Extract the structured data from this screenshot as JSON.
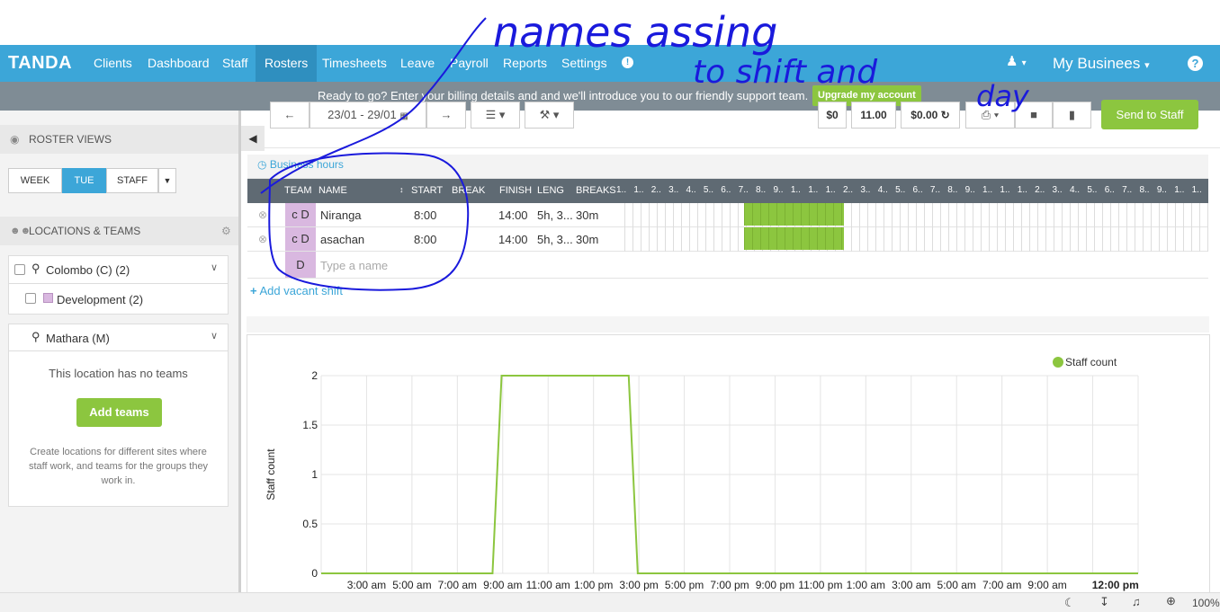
{
  "nav": {
    "logo": "TANDA",
    "items": [
      "Clients",
      "Dashboard",
      "Staff",
      "Rosters",
      "Timesheets",
      "Leave",
      "Payroll",
      "Reports",
      "Settings"
    ],
    "active": "Rosters",
    "business": "My Businees",
    "help_icon": "help-circle-icon"
  },
  "banner": {
    "text": "Ready to go? Enter your billing details and and we'll introduce you to our friendly support team.",
    "button": "Upgrade my account"
  },
  "left": {
    "roster_views": "ROSTER VIEWS",
    "view_buttons": [
      "WEEK",
      "TUE",
      "STAFF"
    ],
    "view_active": "TUE",
    "locations_title": "LOCATIONS & TEAMS",
    "loc1": "Colombo (C) (2)",
    "loc1_team": "Development (2)",
    "loc2": "Mathara (M)",
    "no_teams": "This location has no teams",
    "add_teams": "Add teams",
    "help_text": "Create locations for different sites where staff work, and teams for the groups they work in."
  },
  "toolbar": {
    "date_range": "23/01 - 29/01",
    "cost": "$0",
    "hours": "11.00",
    "wage": "$0.00",
    "send": "Send to Staff"
  },
  "business_hours": "Business hours",
  "table": {
    "headers": {
      "team": "TEAM",
      "name": "NAME",
      "start": "START",
      "break": "BREAK",
      "finish": "FINISH",
      "length": "LENG",
      "breaks": "BREAKS"
    },
    "hour_labels": [
      "1..",
      "1..",
      "2..",
      "3..",
      "4..",
      "5..",
      "6..",
      "7..",
      "8..",
      "9..",
      "1..",
      "1..",
      "1..",
      "2..",
      "3..",
      "4..",
      "5..",
      "6..",
      "7..",
      "8..",
      "9..",
      "1..",
      "1..",
      "1..",
      "2..",
      "3..",
      "4..",
      "5..",
      "6..",
      "7..",
      "8..",
      "9..",
      "1..",
      "1.."
    ],
    "rows": [
      {
        "team": "c D",
        "name": "Niranga",
        "start": "8:00",
        "finish": "14:00",
        "length": "5h, 3...",
        "breaks": "30m"
      },
      {
        "team": "c D",
        "name": "asachan",
        "start": "8:00",
        "finish": "14:00",
        "length": "5h, 3...",
        "breaks": "30m"
      }
    ],
    "new_row_team": "D",
    "new_row_placeholder": "Type a name",
    "add_vacant": "Add vacant shift"
  },
  "chart_data": {
    "type": "line",
    "title": "",
    "xlabel": "",
    "ylabel": "Staff count",
    "ylim": [
      0,
      2
    ],
    "yticks": [
      "0",
      "0.5",
      "1",
      "1.5",
      "2"
    ],
    "x": [
      "3:00 am",
      "5:00 am",
      "7:00 am",
      "9:00 am",
      "11:00 am",
      "1:00 pm",
      "3:00 pm",
      "5:00 pm",
      "7:00 pm",
      "9:00 pm",
      "11:00 pm",
      "1:00 am",
      "3:00 am",
      "5:00 am",
      "7:00 am",
      "9:00 am",
      "12:00 pm"
    ],
    "series": [
      {
        "name": "Staff count",
        "color": "#8cc63f",
        "points": [
          [
            0,
            0
          ],
          [
            7.55,
            0
          ],
          [
            7.95,
            2
          ],
          [
            13.55,
            2
          ],
          [
            13.95,
            0
          ],
          [
            36,
            0
          ]
        ]
      }
    ],
    "legend": "top-right"
  },
  "status": {
    "zoom": "100%"
  },
  "annotation": {
    "line1": "names assing",
    "line2": "to shift and",
    "line3": "day"
  }
}
